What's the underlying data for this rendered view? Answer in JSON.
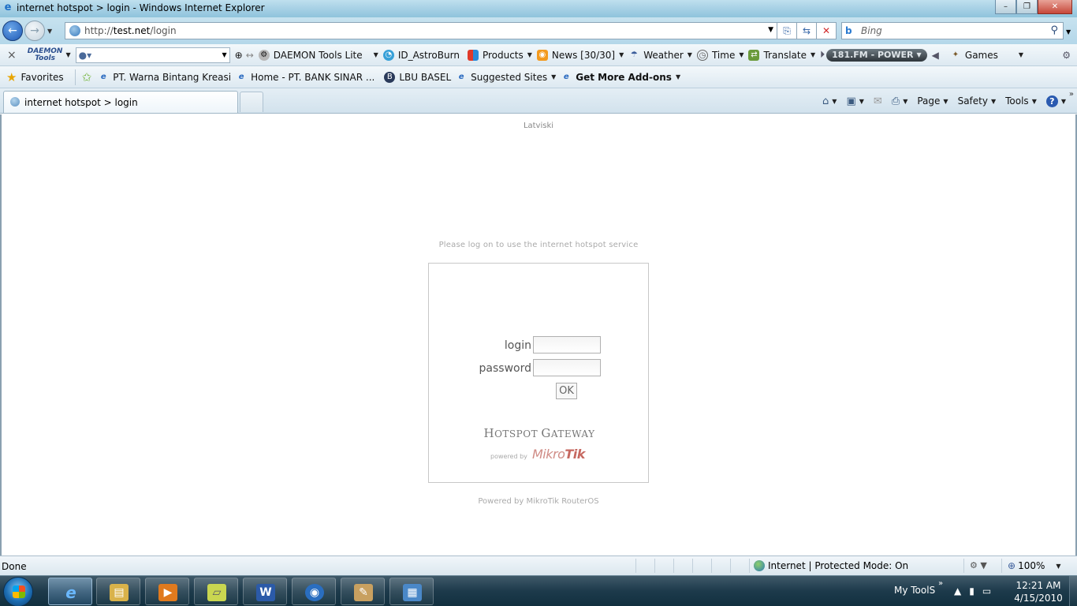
{
  "window": {
    "title": "internet hotspot > login - Windows Internet Explorer",
    "minimize": "–",
    "maximize": "❐",
    "close": "✕"
  },
  "address": {
    "url_prefix": "http://",
    "url_host": "test.net",
    "url_path": "/login",
    "search_placeholder": "Bing"
  },
  "daemon_toolbar": {
    "close": "×",
    "logo_line1": "DAEMON",
    "logo_line2": "Tools",
    "items": [
      {
        "label": "DAEMON Tools Lite",
        "icon": "daemon-icon"
      },
      {
        "label": "ID_AstroBurn",
        "icon": "astroburn-icon"
      },
      {
        "label": "Products",
        "icon": "products-icon"
      },
      {
        "label": "News [30/30]",
        "icon": "rss-icon"
      },
      {
        "label": "Weather",
        "icon": "umbrella-icon"
      },
      {
        "label": "Time",
        "icon": "clock-icon"
      },
      {
        "label": "Translate",
        "icon": "translate-icon"
      },
      {
        "label": "Games",
        "icon": "games-icon"
      }
    ],
    "radio_label": "181.FM - POWER"
  },
  "favorites_bar": {
    "favorites_label": "Favorites",
    "links": [
      {
        "label": "PT. Warna Bintang Kreasi"
      },
      {
        "label": "Home - PT. BANK SINAR ..."
      },
      {
        "label": "LBU BASEL"
      },
      {
        "label": "Suggested Sites"
      },
      {
        "label": "Get More Add-ons"
      }
    ]
  },
  "tabs": [
    {
      "title": "internet hotspot > login"
    }
  ],
  "command_bar": {
    "page": "Page",
    "safety": "Safety",
    "tools": "Tools",
    "help": "?"
  },
  "page": {
    "language_link": "Latviski",
    "notice": "Please log on to use the internet hotspot service",
    "login_label": "login",
    "password_label": "password",
    "login_value": "",
    "password_value": "",
    "ok_label": "OK",
    "gateway_title_big1": "H",
    "gateway_title_small1": "OTSPOT ",
    "gateway_title_big2": "G",
    "gateway_title_small2": "ATEWAY",
    "powered_by_small": "powered by",
    "mikrotik_light": "Mikro",
    "mikrotik_bold": "Tik",
    "footer": "Powered by MikroTik RouterOS"
  },
  "status_bar": {
    "status": "Done",
    "zone": "Internet | Protected Mode: On",
    "zoom": "100%"
  },
  "taskbar": {
    "my_tools": "My ToolS",
    "tray_arrow": "»",
    "time": "12:21 AM",
    "date": "4/15/2010",
    "apps": [
      {
        "name": "internet-explorer",
        "glyph": "e",
        "color": "#2a7ad0"
      },
      {
        "name": "windows-explorer",
        "glyph": "▤",
        "color": "#d9b24a"
      },
      {
        "name": "media-player",
        "glyph": "▶",
        "color": "#e07a1e"
      },
      {
        "name": "sticky-notes",
        "glyph": "▱",
        "color": "#c9d650"
      },
      {
        "name": "word",
        "glyph": "W",
        "color": "#2b5aa8"
      },
      {
        "name": "teamviewer",
        "glyph": "◉",
        "color": "#2a6ec0"
      },
      {
        "name": "paint",
        "glyph": "✎",
        "color": "#c8a060"
      },
      {
        "name": "remote-desktop",
        "glyph": "▦",
        "color": "#4a88c8"
      }
    ]
  }
}
